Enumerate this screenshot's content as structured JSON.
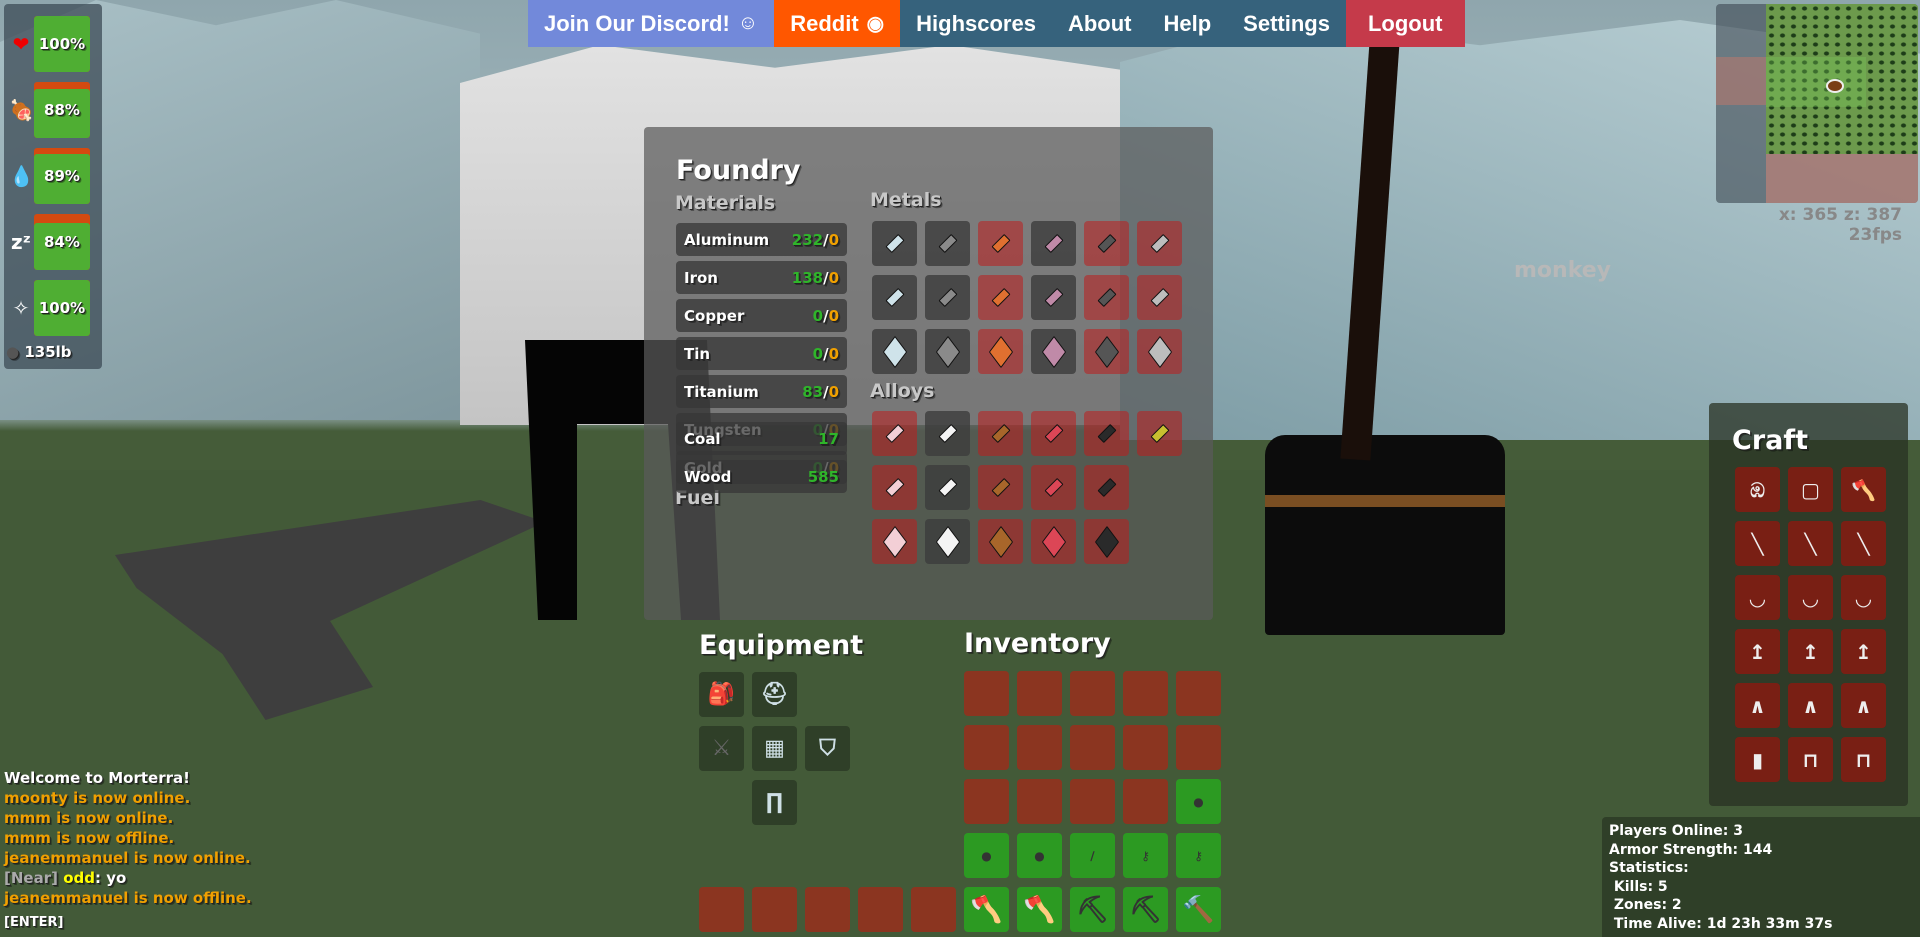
{
  "nav": [
    {
      "label": "Join Our Discord!",
      "icon": "discord-icon",
      "color": "#7289da"
    },
    {
      "label": "Reddit",
      "icon": "reddit-icon",
      "color": "#ff5700"
    },
    {
      "label": "Highscores",
      "color": "#36627c"
    },
    {
      "label": "About",
      "color": "#36627c"
    },
    {
      "label": "Help",
      "color": "#36627c"
    },
    {
      "label": "Settings",
      "color": "#36627c"
    },
    {
      "label": "Logout",
      "color": "#c53a4a"
    }
  ],
  "status": [
    {
      "icon": "heart-icon",
      "value": "100%",
      "level": 100
    },
    {
      "icon": "meat-icon",
      "value": "88%",
      "level": 88
    },
    {
      "icon": "water-drop-icon",
      "value": "89%",
      "level": 89
    },
    {
      "icon": "sleep-icon",
      "value": "84%",
      "level": 84
    },
    {
      "icon": "spirit-icon",
      "value": "100%",
      "level": 100
    }
  ],
  "weight": "135lb",
  "foundry": {
    "title": "Foundry",
    "materials_label": "Materials",
    "metals_label": "Metals",
    "alloys_label": "Alloys",
    "fuel_label": "Fuel",
    "materials": [
      {
        "name": "Aluminum",
        "have": "232",
        "need": "0"
      },
      {
        "name": "Iron",
        "have": "138",
        "need": "0"
      },
      {
        "name": "Copper",
        "have": "0",
        "need": "0"
      },
      {
        "name": "Tin",
        "have": "0",
        "need": "0"
      },
      {
        "name": "Titanium",
        "have": "83",
        "need": "0"
      },
      {
        "name": "Tungsten",
        "have": "0",
        "need": "0"
      },
      {
        "name": "Gold",
        "have": "0",
        "need": "0"
      }
    ],
    "fuel": [
      {
        "name": "Coal",
        "amount": "17"
      },
      {
        "name": "Wood",
        "amount": "585"
      }
    ],
    "metal_colors": [
      "#cfe3ea",
      "#8a8a8a",
      "#e07030",
      "#c08aa8",
      "#555555",
      "#bdbdbd"
    ],
    "metal_available": [
      true,
      true,
      false,
      true,
      false,
      false
    ],
    "alloy_colors": [
      "#f3cfd6",
      "#f4f4f4",
      "#a8662a",
      "#dc4656",
      "#2a2a2a",
      "#c8c030"
    ],
    "alloy_available_row1": [
      false,
      true,
      false,
      false,
      false,
      false
    ],
    "alloy_available": [
      false,
      true,
      false,
      false,
      false
    ]
  },
  "equipment": {
    "title": "Equipment",
    "slots": [
      "backpack-icon",
      "helmet-icon",
      "sword-icon",
      "chestplate-icon",
      "shield-icon",
      "leggings-icon"
    ]
  },
  "inventory": {
    "title": "Inventory",
    "slots": [
      "",
      "",
      "",
      "",
      "",
      "",
      "",
      "",
      "",
      "",
      "",
      "",
      "",
      "",
      "ore",
      "ore",
      "ore",
      "knife",
      "key",
      "key",
      "axe",
      "axe",
      "pickaxe",
      "pickaxe",
      "hammer"
    ],
    "hotbar": [
      "",
      "",
      "",
      "",
      ""
    ]
  },
  "craft": {
    "title": "Craft",
    "items": [
      "rope",
      "cloth",
      "axe",
      "spear",
      "spear",
      "spear",
      "bow",
      "bow",
      "bow",
      "arrow",
      "arrow",
      "arrow",
      "crossbow",
      "crossbow",
      "crossbow",
      "mix-barrel",
      "workbench",
      "workbench"
    ]
  },
  "stats": [
    "Players Online: 3",
    "Armor Strength: 144",
    "Statistics:",
    " Kills: 5",
    " Zones: 2",
    " Time Alive: 1d 23h 33m 37s"
  ],
  "chat": [
    {
      "text": "Welcome to Morterra!",
      "color": "#ffffff"
    },
    {
      "text": "moonty is now online.",
      "color": "#f0a000"
    },
    {
      "text": "mmm is now online.",
      "color": "#f0a000"
    },
    {
      "text": "mmm is now offline.",
      "color": "#f0a000"
    },
    {
      "text": "jeanemmanuel is now online.",
      "color": "#f0a000"
    },
    {
      "prefix": "[Near]",
      "name": "odd",
      "text": ": yo"
    },
    {
      "text": "jeanemmanuel is now offline.",
      "color": "#f0a000"
    }
  ],
  "chat_prompt": "[ENTER]",
  "coords": "x: 365 z: 387",
  "fps": "23fps",
  "player_name": "monkey"
}
